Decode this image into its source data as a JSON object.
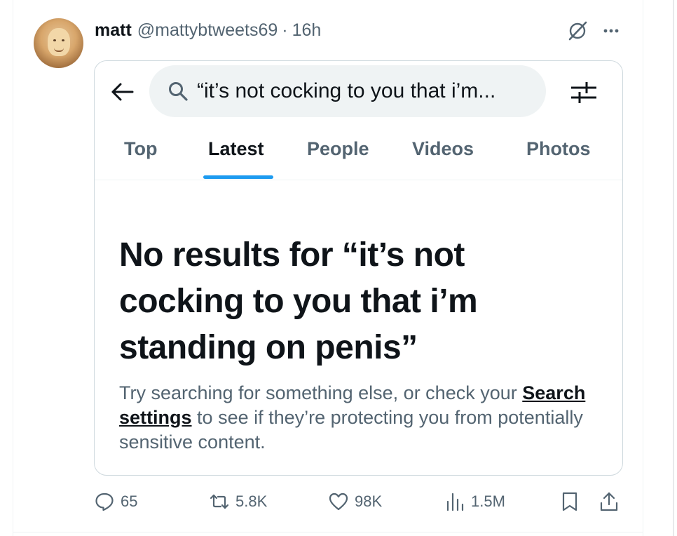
{
  "tweet": {
    "author_name": "matt",
    "author_handle": "@mattybtweets69",
    "separator": "·",
    "time": "16h"
  },
  "embedded": {
    "search_query": "“it’s not cocking to you that i’m...",
    "tabs": [
      {
        "label": "Top"
      },
      {
        "label": "Latest"
      },
      {
        "label": "People"
      },
      {
        "label": "Videos"
      },
      {
        "label": "Photos"
      }
    ],
    "active_tab": "Latest",
    "no_results_title": "No results for “it’s not cocking to you that i’m standing on penis”",
    "help_text_before": "Try searching for something else, or check your",
    "help_link": "Search settings",
    "help_text_after": "to see if they’re protecting you from potentially sensitive content."
  },
  "actions": {
    "replies": "65",
    "reposts": "5.8K",
    "likes": "98K",
    "views": "1.5M"
  },
  "colors": {
    "accent": "#1d9bf0",
    "text_primary": "#0f1419",
    "text_secondary": "#536471",
    "search_bg": "#eff3f4",
    "border": "#cfd9de"
  },
  "icons": [
    "grok-icon",
    "more-icon",
    "back-arrow-icon",
    "search-icon",
    "filter-icon",
    "reply-icon",
    "repost-icon",
    "like-icon",
    "views-icon",
    "bookmark-icon",
    "share-icon"
  ]
}
